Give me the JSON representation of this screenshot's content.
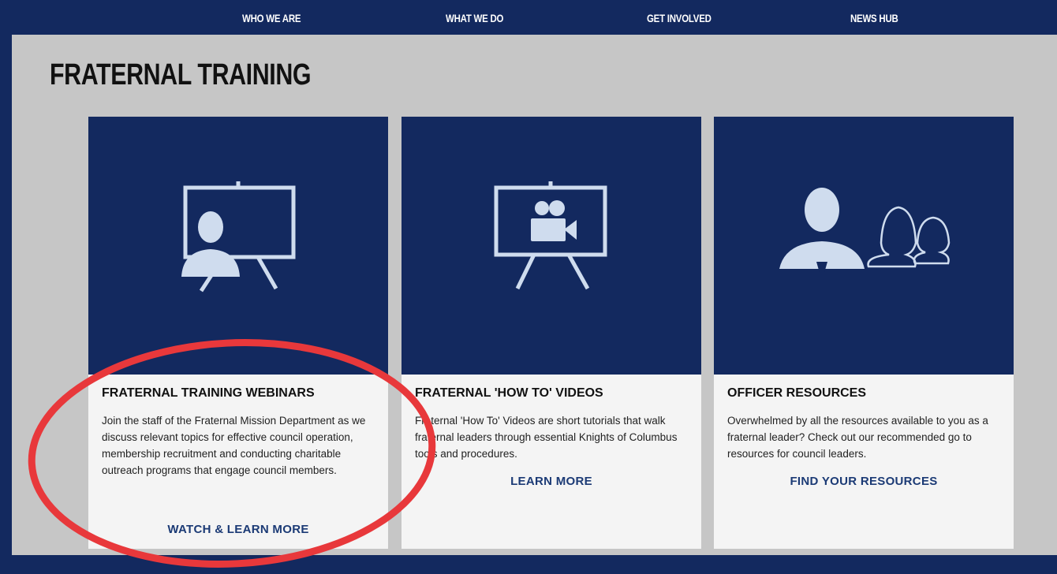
{
  "nav": {
    "items": [
      "WHO WE ARE",
      "WHAT WE DO",
      "GET INVOLVED",
      "NEWS HUB"
    ]
  },
  "page_title": "FRATERNAL TRAINING",
  "cards": [
    {
      "icon": "presentation-person-icon",
      "title": "FRATERNAL TRAINING WEBINARS",
      "description": "Join the staff of the Fraternal Mission Department as we discuss relevant topics for effective council operation, membership recruitment and conducting charitable outreach programs that engage council members.",
      "link": "WATCH & LEARN MORE"
    },
    {
      "icon": "presentation-video-icon",
      "title": "FRATERNAL 'HOW TO' VIDEOS",
      "description": "Fraternal 'How To' Videos are short tutorials that walk fraternal leaders through essential Knights of Columbus tools and procedures.",
      "link": "LEARN MORE"
    },
    {
      "icon": "people-group-icon",
      "title": "OFFICER RESOURCES",
      "description": "Overwhelmed by all the resources available to you as a fraternal leader? Check out our recommended go to resources for council leaders.",
      "link": "FIND YOUR RESOURCES"
    }
  ],
  "colors": {
    "navy": "#13295f",
    "panel_gray": "#c6c6c6",
    "link_blue": "#1b3a75",
    "annotation_red": "#e8383b"
  }
}
